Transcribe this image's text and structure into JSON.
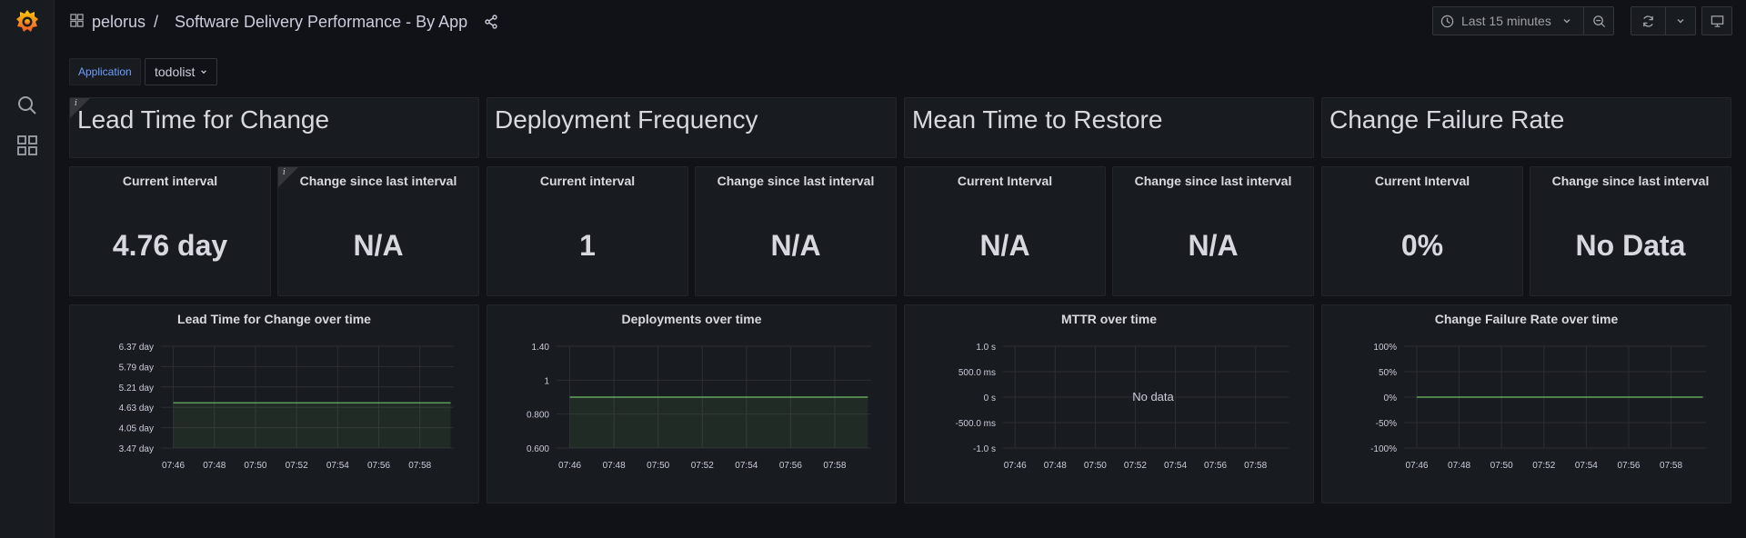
{
  "colors": {
    "background": "#111217",
    "panel": "#181b1f",
    "series_line": "#73bf69",
    "link": "#6e9fff"
  },
  "icons": {
    "logo": "grafana-logo-icon",
    "search": "search-icon",
    "dashboards": "dashboards-grid-icon",
    "share": "share-icon",
    "clock": "clock-icon",
    "zoom_out": "zoom-out-icon",
    "refresh": "refresh-icon",
    "tv": "tv-mode-icon"
  },
  "breadcrumb": {
    "folder": "pelorus",
    "separator": "/",
    "dashboard": "Software Delivery Performance - By App"
  },
  "toolbar": {
    "time_range": "Last 15 minutes"
  },
  "variables": {
    "label": "Application",
    "value": "todolist"
  },
  "sections": [
    {
      "title": "Lead Time for Change",
      "has_info": true
    },
    {
      "title": "Deployment Frequency",
      "has_info": false
    },
    {
      "title": "Mean Time to Restore",
      "has_info": false
    },
    {
      "title": "Change Failure Rate",
      "has_info": false
    }
  ],
  "stats": [
    {
      "title": "Current interval",
      "value": "4.76 day",
      "has_info": false
    },
    {
      "title": "Change since last interval",
      "value": "N/A",
      "has_info": true
    },
    {
      "title": "Current interval",
      "value": "1",
      "has_info": false
    },
    {
      "title": "Change since last interval",
      "value": "N/A",
      "has_info": false
    },
    {
      "title": "Current Interval",
      "value": "N/A",
      "has_info": false
    },
    {
      "title": "Change since last interval",
      "value": "N/A",
      "has_info": false
    },
    {
      "title": "Current Interval",
      "value": "0%",
      "has_info": false
    },
    {
      "title": "Change since last interval",
      "value": "No Data",
      "has_info": false
    }
  ],
  "chart_data": [
    {
      "type": "area",
      "title": "Lead Time for Change over time",
      "xlabel": "",
      "ylabel": "",
      "x_ticks": [
        "07:46",
        "07:48",
        "07:50",
        "07:52",
        "07:54",
        "07:56",
        "07:58"
      ],
      "y_ticks": [
        "6.37 day",
        "5.79 day",
        "5.21 day",
        "4.63 day",
        "4.05 day",
        "3.47 day"
      ],
      "ylim": [
        3.47,
        6.37
      ],
      "grid": true,
      "x_start": "07:46",
      "x_end": "07:59:30",
      "series": [
        {
          "values": [
            4.76,
            4.76
          ]
        }
      ],
      "no_data": false,
      "no_data_text": ""
    },
    {
      "type": "area",
      "title": "Deployments over time",
      "xlabel": "",
      "ylabel": "",
      "x_ticks": [
        "07:46",
        "07:48",
        "07:50",
        "07:52",
        "07:54",
        "07:56",
        "07:58"
      ],
      "y_ticks": [
        "1.40",
        "1",
        "0.800",
        "0.600"
      ],
      "ylim": [
        0.6,
        1.4
      ],
      "grid": true,
      "x_start": "07:46",
      "x_end": "07:59:30",
      "series": [
        {
          "values": [
            1,
            1
          ]
        }
      ],
      "no_data": false,
      "no_data_text": ""
    },
    {
      "type": "line",
      "title": "MTTR over time",
      "xlabel": "",
      "ylabel": "",
      "x_ticks": [
        "07:46",
        "07:48",
        "07:50",
        "07:52",
        "07:54",
        "07:56",
        "07:58"
      ],
      "y_ticks": [
        "1.0 s",
        "500.0 ms",
        "0 s",
        "-500.0 ms",
        "-1.0 s"
      ],
      "ylim": [
        -1,
        1
      ],
      "grid": true,
      "series": [],
      "no_data": true,
      "no_data_text": "No data"
    },
    {
      "type": "line",
      "title": "Change Failure Rate over time",
      "xlabel": "",
      "ylabel": "",
      "x_ticks": [
        "07:46",
        "07:48",
        "07:50",
        "07:52",
        "07:54",
        "07:56",
        "07:58"
      ],
      "y_ticks": [
        "100%",
        "50%",
        "0%",
        "-50%",
        "-100%"
      ],
      "ylim": [
        -100,
        100
      ],
      "grid": true,
      "x_start": "07:46",
      "x_end": "07:59:30",
      "series": [
        {
          "values": [
            0,
            0
          ]
        }
      ],
      "no_data": false,
      "no_data_text": ""
    }
  ]
}
